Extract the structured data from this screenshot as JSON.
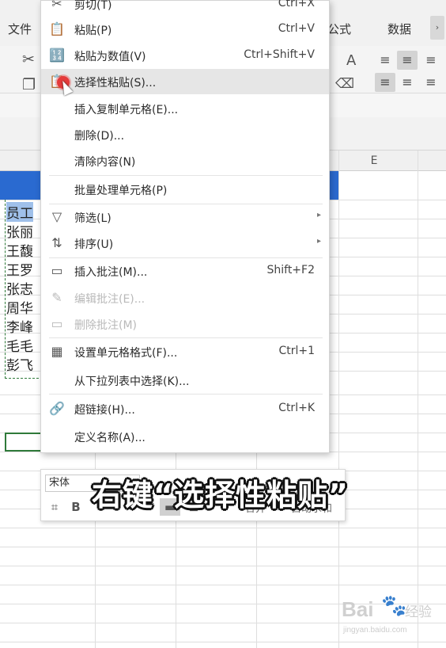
{
  "ribbon": {
    "tabs": [
      {
        "label": "文件"
      },
      {
        "label": "公式"
      },
      {
        "label": "数据"
      }
    ],
    "scroll_glyph": "›",
    "icons": {
      "cut": "✂",
      "copy": "❐",
      "font_size": "A",
      "eraser": "⌫"
    }
  },
  "sheet": {
    "column_header_e": "E",
    "names": [
      "员工",
      "张丽",
      "王馥",
      "王罗",
      "张志",
      "周华",
      "李峰",
      "毛毛",
      "彭飞"
    ]
  },
  "context_menu": {
    "items": [
      {
        "label": "剪切(T)",
        "shortcut": "Ctrl+X",
        "icon": "✂",
        "state": "normal"
      },
      {
        "label": "粘贴(P)",
        "shortcut": "Ctrl+V",
        "icon": "📋",
        "state": "normal"
      },
      {
        "label": "粘贴为数值(V)",
        "shortcut": "Ctrl+Shift+V",
        "icon": "🔢",
        "state": "normal"
      },
      {
        "label": "选择性粘贴(S)...",
        "shortcut": "",
        "icon": "📋",
        "state": "hover"
      },
      {
        "label": "插入复制单元格(E)...",
        "shortcut": "",
        "icon": "",
        "state": "normal"
      },
      {
        "label": "删除(D)...",
        "shortcut": "",
        "icon": "",
        "state": "normal"
      },
      {
        "label": "清除内容(N)",
        "shortcut": "",
        "icon": "",
        "state": "normal"
      },
      {
        "label": "批量处理单元格(P)",
        "shortcut": "",
        "icon": "",
        "state": "normal"
      },
      {
        "label": "筛选(L)",
        "shortcut": "",
        "icon": "▽",
        "state": "submenu"
      },
      {
        "label": "排序(U)",
        "shortcut": "",
        "icon": "⇅",
        "state": "submenu"
      },
      {
        "label": "插入批注(M)...",
        "shortcut": "Shift+F2",
        "icon": "▭",
        "state": "normal"
      },
      {
        "label": "编辑批注(E)...",
        "shortcut": "",
        "icon": "✎",
        "state": "disabled"
      },
      {
        "label": "删除批注(M)",
        "shortcut": "",
        "icon": "▭",
        "state": "disabled"
      },
      {
        "label": "设置单元格格式(F)...",
        "shortcut": "Ctrl+1",
        "icon": "▦",
        "state": "normal"
      },
      {
        "label": "从下拉列表中选择(K)...",
        "shortcut": "",
        "icon": "",
        "state": "normal"
      },
      {
        "label": "超链接(H)...",
        "shortcut": "Ctrl+K",
        "icon": "🔗",
        "state": "normal"
      },
      {
        "label": "定义名称(A)...",
        "shortcut": "",
        "icon": "",
        "state": "normal"
      }
    ]
  },
  "mini_toolbar": {
    "font": "宋体",
    "bold": "B",
    "right_label_1": "合并",
    "right_label_2": "自动求和"
  },
  "caption": "右键“选择性粘贴”",
  "watermark": {
    "logo": "Bai",
    "paw": "🐾",
    "text": "经验",
    "url": "jingyan.baidu.com"
  }
}
